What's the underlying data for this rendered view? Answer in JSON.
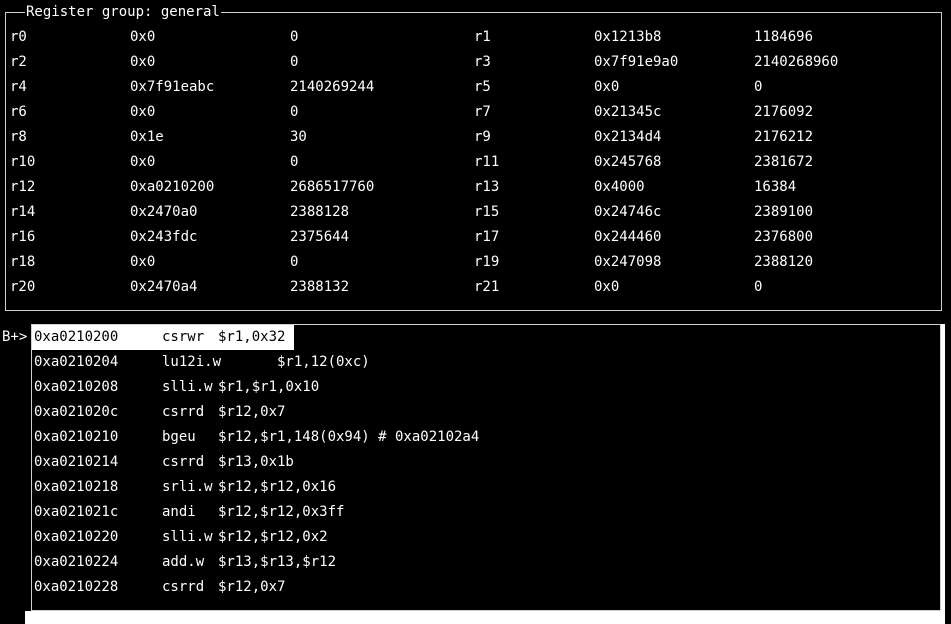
{
  "register_panel": {
    "title": "Register group: general",
    "rows": [
      [
        {
          "name": "r0",
          "hex": "0x0",
          "dec": "0"
        },
        {
          "name": "r1",
          "hex": "0x1213b8",
          "dec": "1184696"
        }
      ],
      [
        {
          "name": "r2",
          "hex": "0x0",
          "dec": "0"
        },
        {
          "name": "r3",
          "hex": "0x7f91e9a0",
          "dec": "2140268960"
        }
      ],
      [
        {
          "name": "r4",
          "hex": "0x7f91eabc",
          "dec": "2140269244"
        },
        {
          "name": "r5",
          "hex": "0x0",
          "dec": "0"
        }
      ],
      [
        {
          "name": "r6",
          "hex": "0x0",
          "dec": "0"
        },
        {
          "name": "r7",
          "hex": "0x21345c",
          "dec": "2176092"
        }
      ],
      [
        {
          "name": "r8",
          "hex": "0x1e",
          "dec": "30"
        },
        {
          "name": "r9",
          "hex": "0x2134d4",
          "dec": "2176212"
        }
      ],
      [
        {
          "name": "r10",
          "hex": "0x0",
          "dec": "0"
        },
        {
          "name": "r11",
          "hex": "0x245768",
          "dec": "2381672"
        }
      ],
      [
        {
          "name": "r12",
          "hex": "0xa0210200",
          "dec": "2686517760"
        },
        {
          "name": "r13",
          "hex": "0x4000",
          "dec": "16384"
        }
      ],
      [
        {
          "name": "r14",
          "hex": "0x2470a0",
          "dec": "2388128"
        },
        {
          "name": "r15",
          "hex": "0x24746c",
          "dec": "2389100"
        }
      ],
      [
        {
          "name": "r16",
          "hex": "0x243fdc",
          "dec": "2375644"
        },
        {
          "name": "r17",
          "hex": "0x244460",
          "dec": "2376800"
        }
      ],
      [
        {
          "name": "r18",
          "hex": "0x0",
          "dec": "0"
        },
        {
          "name": "r19",
          "hex": "0x247098",
          "dec": "2388120"
        }
      ],
      [
        {
          "name": "r20",
          "hex": "0x2470a4",
          "dec": "2388132"
        },
        {
          "name": "r21",
          "hex": "0x0",
          "dec": "0"
        }
      ]
    ]
  },
  "asm_panel": {
    "breakpoint_marker": "B+>",
    "current_index": 0,
    "lines": [
      {
        "addr": "0xa0210200",
        "mnem": "csrwr",
        "ops": "$r1,0x32"
      },
      {
        "addr": "0xa0210204",
        "mnem": "lu12i.w",
        "ops": "       $r1,12(0xc)"
      },
      {
        "addr": "0xa0210208",
        "mnem": "slli.w",
        "ops": "$r1,$r1,0x10"
      },
      {
        "addr": "0xa021020c",
        "mnem": "csrrd",
        "ops": "$r12,0x7"
      },
      {
        "addr": "0xa0210210",
        "mnem": "bgeu",
        "ops": "$r12,$r1,148(0x94) # 0xa02102a4"
      },
      {
        "addr": "0xa0210214",
        "mnem": "csrrd",
        "ops": "$r13,0x1b"
      },
      {
        "addr": "0xa0210218",
        "mnem": "srli.w",
        "ops": "$r12,$r12,0x16"
      },
      {
        "addr": "0xa021021c",
        "mnem": "andi",
        "ops": "$r12,$r12,0x3ff"
      },
      {
        "addr": "0xa0210220",
        "mnem": "slli.w",
        "ops": "$r12,$r12,0x2"
      },
      {
        "addr": "0xa0210224",
        "mnem": "add.w",
        "ops": "$r13,$r13,$r12"
      },
      {
        "addr": "0xa0210228",
        "mnem": "csrrd",
        "ops": "$r12,0x7"
      }
    ]
  }
}
